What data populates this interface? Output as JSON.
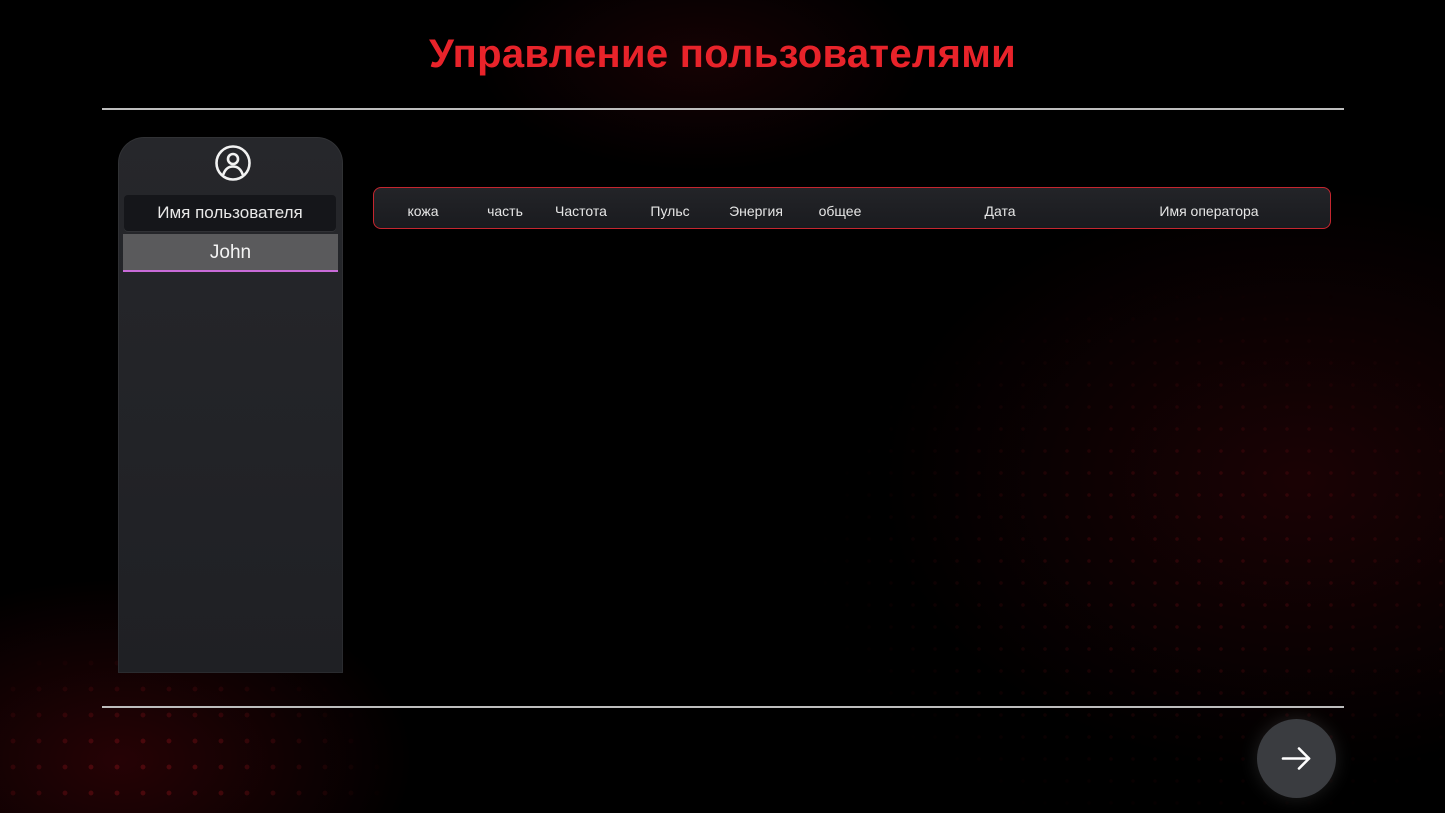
{
  "header": {
    "title": "Управление пользователями"
  },
  "user_panel": {
    "icon": "user-circle-icon",
    "header_label": "Имя пользователя",
    "users": [
      {
        "name": "John",
        "selected": true
      }
    ]
  },
  "table": {
    "columns": [
      "кожа",
      "часть",
      "Частота",
      "Пульс",
      "Энергия",
      "общее",
      "Дата",
      "Имя оператора"
    ],
    "rows": []
  },
  "footer": {
    "next_icon": "arrow-right-icon"
  },
  "colors": {
    "accent": "#e8232a",
    "border": "#c5262f",
    "selection_underline": "#c86bd8"
  }
}
